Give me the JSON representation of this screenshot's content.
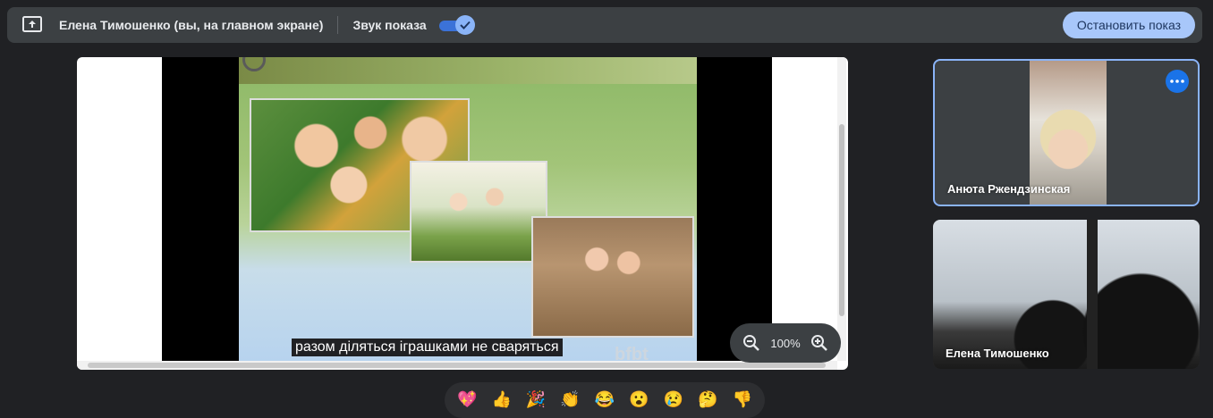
{
  "topbar": {
    "presenter_label": "Елена Тимошенко (вы, на главном экране)",
    "sound_label": "Звук показа",
    "sound_enabled": true,
    "stop_button": "Остановить показ",
    "icon": "present-screen-icon"
  },
  "stage": {
    "caption": "разом діляться іграшками не сваряться",
    "watermark": "bfbt",
    "zoom_level": "100%",
    "zoom_out_icon": "zoom-out-icon",
    "zoom_in_icon": "zoom-in-icon"
  },
  "participants": [
    {
      "name": "Анюта Ржендзинская",
      "active_speaker": true
    },
    {
      "name": "Елена Тимошенко",
      "active_speaker": false
    }
  ],
  "reactions": [
    {
      "icon": "sparkling-heart-icon",
      "glyph": "💖"
    },
    {
      "icon": "thumbs-up-icon",
      "glyph": "👍"
    },
    {
      "icon": "party-popper-icon",
      "glyph": "🎉"
    },
    {
      "icon": "clapping-hands-icon",
      "glyph": "👏"
    },
    {
      "icon": "tears-of-joy-icon",
      "glyph": "😂"
    },
    {
      "icon": "surprised-face-icon",
      "glyph": "😮"
    },
    {
      "icon": "sad-face-icon",
      "glyph": "😢"
    },
    {
      "icon": "thinking-face-icon",
      "glyph": "🤔"
    },
    {
      "icon": "thumbs-down-icon",
      "glyph": "👎"
    }
  ],
  "colors": {
    "background": "#202124",
    "bar": "#3c4043",
    "accent": "#8ab4f8",
    "stop_button_bg": "#a8c7fa"
  }
}
